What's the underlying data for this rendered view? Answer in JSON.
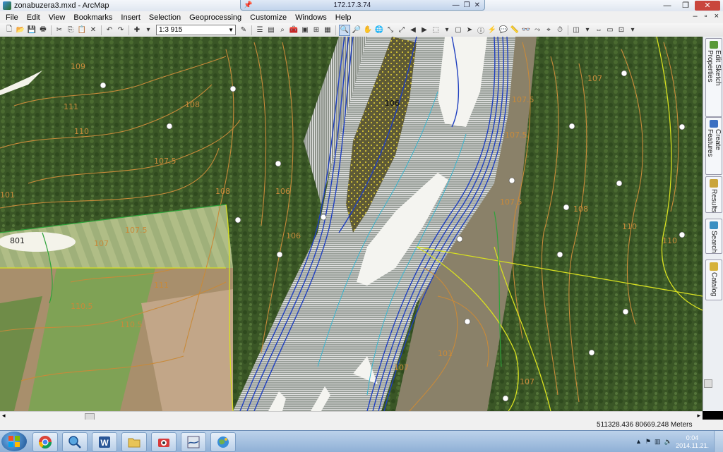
{
  "remote_session": {
    "address": "172.17.3.74"
  },
  "window": {
    "title": "zonabuzera3.mxd - ArcMap"
  },
  "menus": [
    "File",
    "Edit",
    "View",
    "Bookmarks",
    "Insert",
    "Selection",
    "Geoprocessing",
    "Customize",
    "Windows",
    "Help"
  ],
  "toolbar": {
    "scale": "1:3 915"
  },
  "map": {
    "contour_labels": [
      "109",
      "111",
      "108",
      "110",
      "107.5",
      "108",
      "107.5",
      "107",
      "110.5",
      "111",
      "110.5",
      "106",
      "106",
      "106",
      "107.5",
      "107.5",
      "107",
      "108",
      "110",
      "110",
      "107",
      "101",
      "107",
      "101",
      "107.5",
      "801"
    ],
    "colors": {
      "river": "#1f3fbf",
      "contour": "#c88a3a",
      "boundary": "#d8e020",
      "forest": "#3b5a26",
      "field": "#b59a78"
    }
  },
  "side_tabs": [
    "Edit Sketch Properties",
    "Create Features",
    "Results",
    "Search",
    "Catalog"
  ],
  "status": {
    "coordinates": "511328.436  80669.248 Meters"
  },
  "taskbar": {
    "apps": [
      "start-orb",
      "chrome",
      "arcgis-explorer",
      "word",
      "file-explorer",
      "camera",
      "hec-ras",
      "arcgis"
    ],
    "clock_time": "0:04",
    "clock_date": "2014.11.21."
  }
}
